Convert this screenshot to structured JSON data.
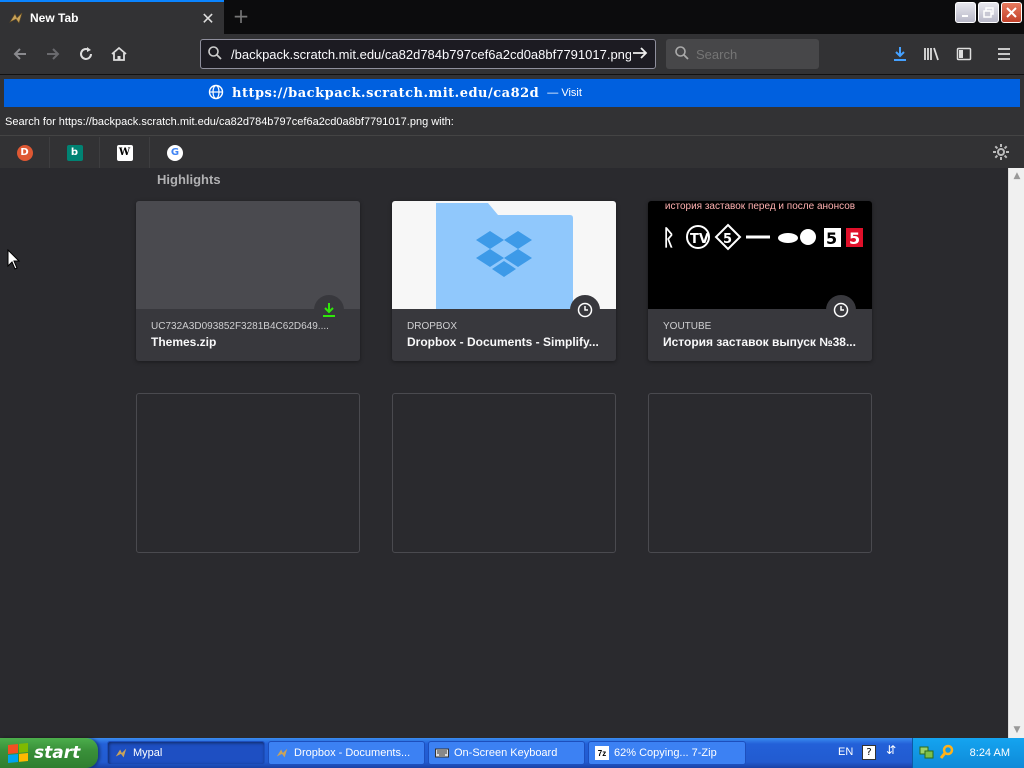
{
  "browser": {
    "tab_title": "New Tab",
    "new_tab_symbol": "+",
    "url": "/backpack.scratch.mit.edu/ca82d784b797cef6a2cd0a8bf7791017.png",
    "search_placeholder": "Search",
    "accent_color": "#0a84ff"
  },
  "url_dropdown": {
    "result_url": "https://backpack.scratch.mit.edu/ca82d",
    "result_action": "— Visit",
    "search_for_text": "Search for https://backpack.scratch.mit.edu/ca82d784b797cef6a2cd0a8bf7791017.png with:",
    "engines": [
      "duckduckgo-icon",
      "bing-icon",
      "wikipedia-icon",
      "google-icon"
    ]
  },
  "highlights": {
    "title": "Highlights",
    "cards": [
      {
        "host": "UC732A3D093852F3281B4C62D649....",
        "title": "Themes.zip",
        "badge": "download-icon"
      },
      {
        "host": "DROPBOX",
        "title": "Dropbox - Documents - Simplify...",
        "badge": "clock-icon"
      },
      {
        "host": "YOUTUBE",
        "title": "История заставок выпуск №38...",
        "badge": "clock-icon",
        "thumb_text": "история заставок перед и после анонсов"
      }
    ]
  },
  "taskbar": {
    "start_label": "start",
    "tasks": [
      {
        "label": "Mypal",
        "active": true
      },
      {
        "label": "Dropbox - Documents...",
        "active": false
      },
      {
        "label": "On-Screen Keyboard",
        "active": false
      },
      {
        "label": "62% Copying... 7-Zip",
        "active": false
      }
    ],
    "language": "EN",
    "help_symbol": "?",
    "clock": "8:24 AM"
  }
}
